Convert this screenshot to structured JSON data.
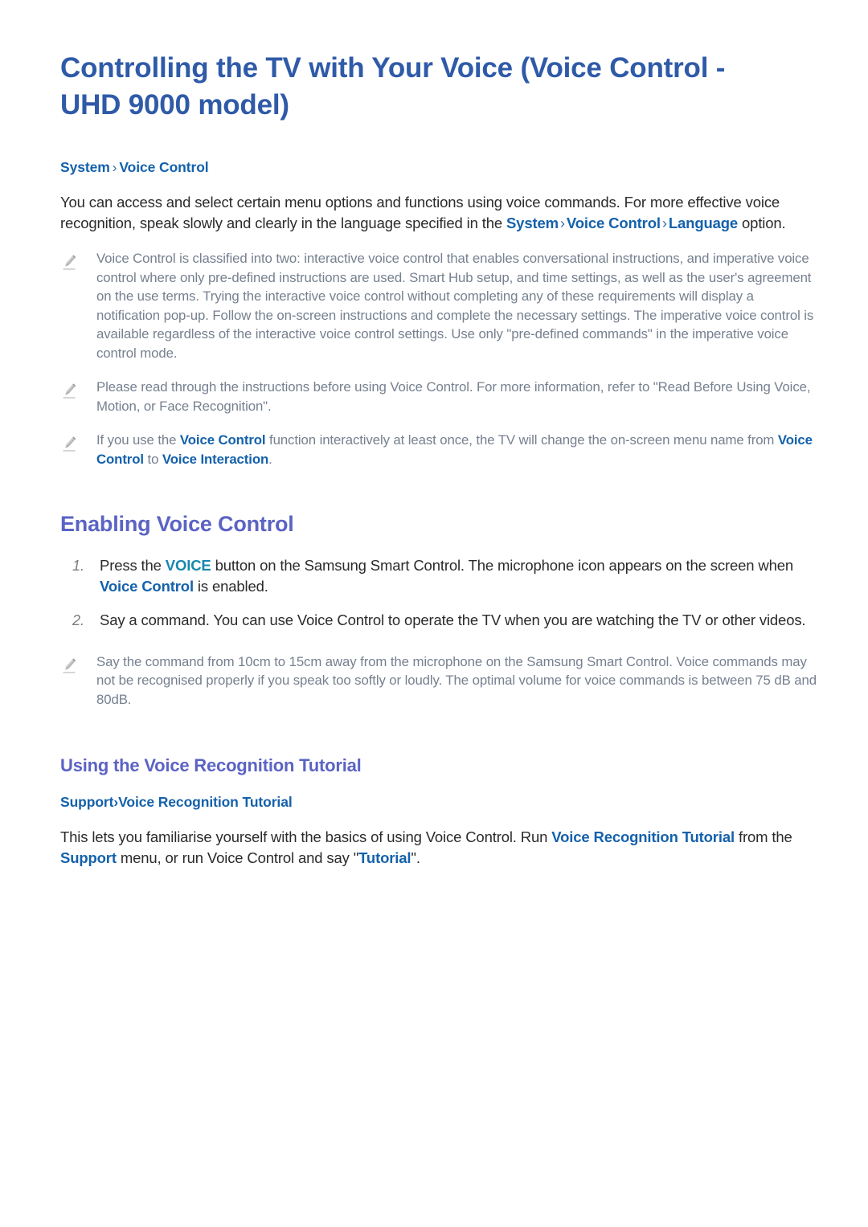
{
  "document": {
    "title": "Controlling the TV with Your Voice (Voice Control - UHD 9000 model)",
    "breadcrumb": {
      "root": "System",
      "separator": "›",
      "leaf": "Voice Control"
    },
    "intro": {
      "part1": "You can access and select certain menu options and functions using voice commands. For more effective voice recognition, speak slowly and clearly in the language specified in the ",
      "link1": "System",
      "sep1": "›",
      "link2": "Voice Control",
      "sep2": "›",
      "link3": "Language",
      "part2": " option."
    },
    "notes": [
      {
        "icon": "pencil-icon",
        "text": "Voice Control is classified into two: interactive voice control that enables conversational instructions, and imperative voice control where only pre-defined instructions are used. Smart Hub setup, and time settings, as well as the user's agreement on the use terms. Trying the interactive voice control without completing any of these requirements will display a notification pop-up. Follow the on-screen instructions and complete the necessary settings. The imperative voice control is available regardless of the interactive voice control settings. Use only \"pre-defined commands\" in the imperative voice control mode."
      },
      {
        "icon": "pencil-icon",
        "text": "Please read through the instructions before using Voice Control. For more information, refer to \"Read Before Using Voice, Motion, or Face Recognition\"."
      },
      {
        "icon": "pencil-icon",
        "prefix": "If you use the ",
        "link1": "Voice Control",
        "middle": " function interactively at least once, the TV will  change the on-screen menu name from ",
        "link2": "Voice Control",
        "joiner": " to ",
        "link3": "Voice Interaction",
        "suffix": "."
      }
    ],
    "section_enabling": {
      "heading": "Enabling Voice Control",
      "steps": [
        {
          "number": "1.",
          "prefix": "Press the ",
          "link1": "VOICE",
          "middle": " button on the Samsung Smart Control. The microphone icon appears on the screen when ",
          "link2": "Voice Control",
          "suffix": " is enabled."
        },
        {
          "number": "2.",
          "text": "Say a command. You can use Voice Control to operate the TV when you are watching the TV or other videos."
        }
      ],
      "note": {
        "icon": "pencil-icon",
        "text": "Say the command from 10cm to 15cm away from the microphone on the Samsung Smart Control. Voice commands may not be recognised properly if you speak too softly or loudly. The optimal volume for voice commands is between 75 dB and 80dB."
      }
    },
    "section_tutorial": {
      "heading": "Using the Voice Recognition Tutorial",
      "breadcrumb": {
        "root": "Support",
        "separator": "›",
        "leaf": "Voice Recognition Tutorial"
      },
      "body": {
        "part1": "This lets you familiarise yourself with the basics of using Voice Control. Run ",
        "link1": "Voice Recognition Tutorial",
        "part2": " from the ",
        "link2": "Support",
        "part3": " menu, or run Voice Control and say \"",
        "link3": "Tutorial",
        "part4": "\"."
      }
    },
    "colors": {
      "title_blue": "#2f5aa8",
      "link_blue": "#1461ab",
      "link_teal": "#1788b0",
      "heading_indigo": "#5b63c4",
      "body_text": "#2b2b2b",
      "note_text": "#76808f",
      "list_number": "#7b7b7b",
      "background": "#ffffff"
    }
  }
}
